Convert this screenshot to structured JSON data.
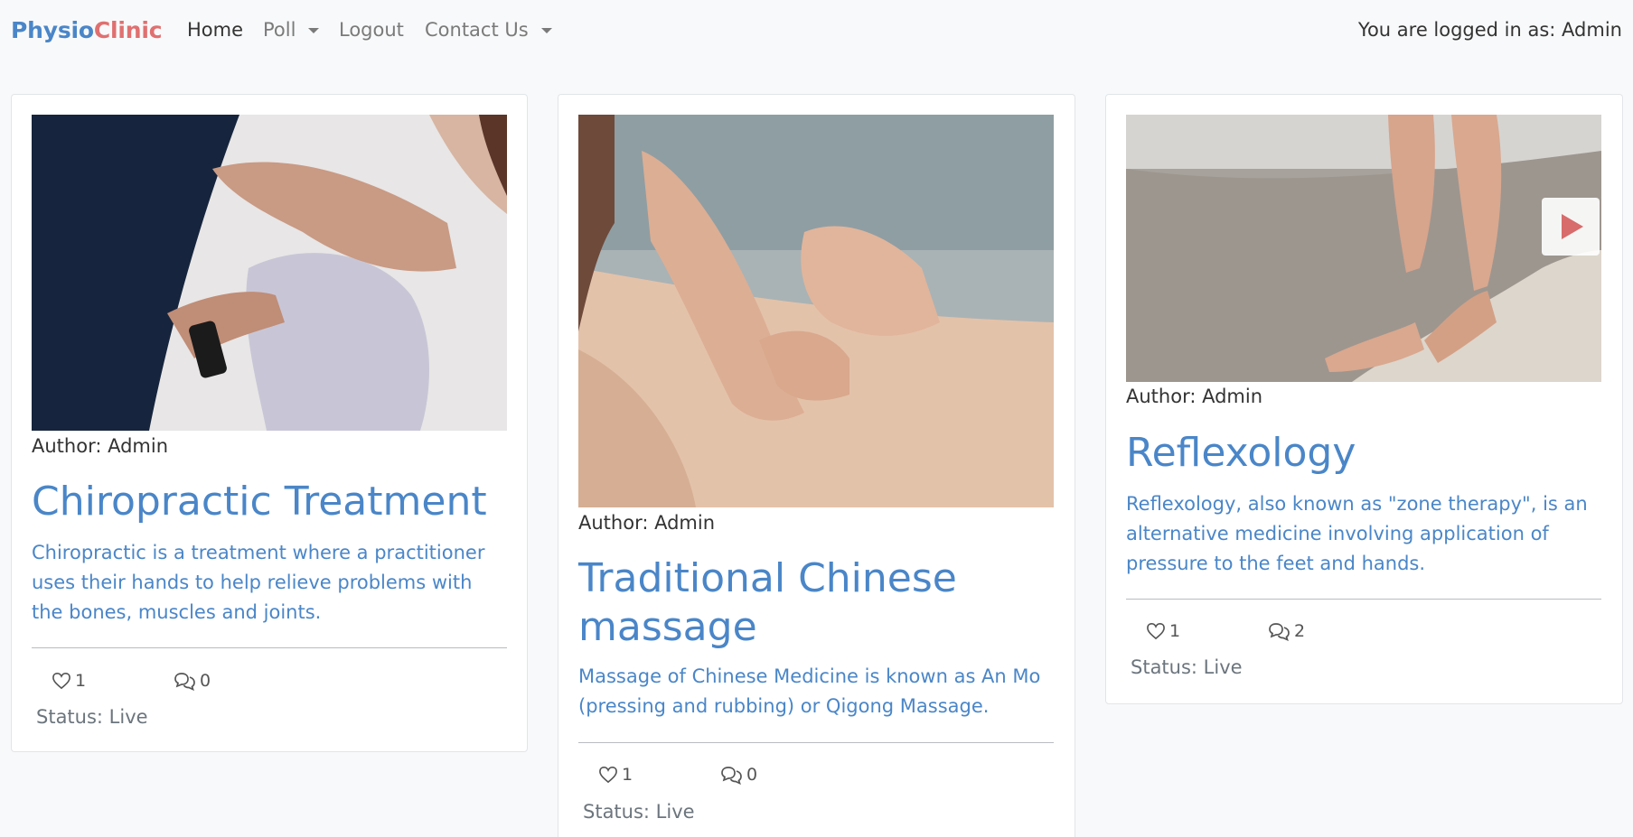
{
  "brand": {
    "part1": "Physio",
    "part2": "Clinic"
  },
  "nav": {
    "home": "Home",
    "poll": "Poll",
    "logout": "Logout",
    "contact": "Contact Us"
  },
  "login_status": "You are logged in as: Admin",
  "colors": {
    "accent": "#4a86c8",
    "brand_secondary": "#e07070"
  },
  "cards": [
    {
      "author": "Author: Admin",
      "title": "Chiropractic Treatment",
      "description": "Chiropractic is a treatment where a practitioner uses their hands to help relieve problems with the bones, muscles and joints.",
      "likes": "1",
      "comments": "0",
      "status": "Status: Live"
    },
    {
      "author": "Author: Admin",
      "title": "Traditional Chinese massage",
      "description": "Massage of Chinese Medicine is known as An Mo (pressing and rubbing) or Qigong Massage.",
      "likes": "1",
      "comments": "0",
      "status": "Status: Live"
    },
    {
      "author": "Author: Admin",
      "title": "Reflexology",
      "description": "Reflexology, also known as \"zone therapy\", is an alternative medicine involving application of pressure to the feet and hands.",
      "likes": "1",
      "comments": "2",
      "status": "Status: Live"
    }
  ]
}
